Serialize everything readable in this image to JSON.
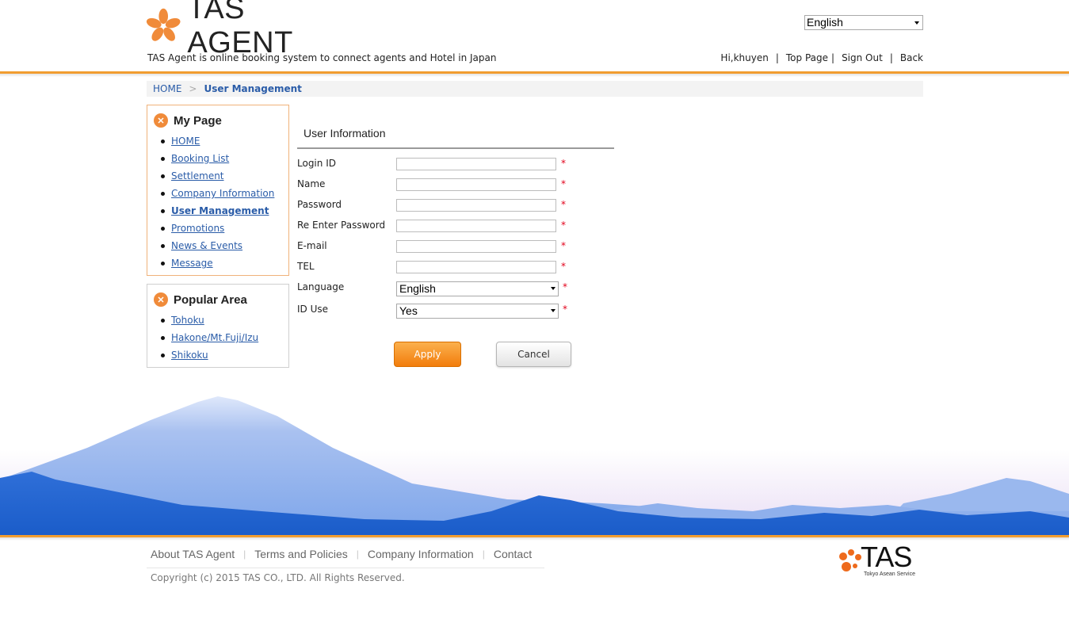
{
  "header": {
    "logo_text": "TAS AGENT",
    "tagline": "TAS Agent is online booking system to connect agents and Hotel in Japan",
    "language": "English",
    "greeting": "Hi,khuyen",
    "top_page": "Top Page",
    "sign_out": "Sign Out",
    "back": "Back"
  },
  "breadcrumb": {
    "home": "HOME",
    "current": "User Management"
  },
  "sidebar": {
    "my_page": {
      "title": "My Page",
      "items": [
        "HOME",
        "Booking List",
        "Settlement",
        "Company Information",
        "User Management",
        "Promotions",
        "News & Events",
        "Message"
      ]
    },
    "popular_area": {
      "title": "Popular Area",
      "items": [
        "Tohoku",
        "Hakone/Mt.Fuji/Izu",
        "Shikoku"
      ]
    }
  },
  "form": {
    "title": "User Information",
    "fields": {
      "login_id": {
        "label": "Login ID",
        "value": ""
      },
      "name": {
        "label": "Name",
        "value": ""
      },
      "password": {
        "label": "Password",
        "value": ""
      },
      "re_password": {
        "label": "Re Enter Password",
        "value": ""
      },
      "email": {
        "label": "E-mail",
        "value": ""
      },
      "tel": {
        "label": "TEL",
        "value": ""
      },
      "language": {
        "label": "Language",
        "value": "English"
      },
      "id_use": {
        "label": "ID Use",
        "value": "Yes"
      }
    },
    "required_mark": "*",
    "apply": "Apply",
    "cancel": "Cancel"
  },
  "footer": {
    "links": [
      "About TAS Agent",
      "Terms and Policies",
      "Company Information",
      "Contact"
    ],
    "copyright": "Copyright (c) 2015 TAS CO., LTD. All Rights Reserved.",
    "logo_text": "TAS",
    "logo_sub": "Tokyo Asean Service"
  },
  "colors": {
    "accent_orange": "#f19d30",
    "link_blue": "#2a5ca8",
    "required_red": "#e2001a",
    "mountain_blue": "#2f6fd8"
  }
}
